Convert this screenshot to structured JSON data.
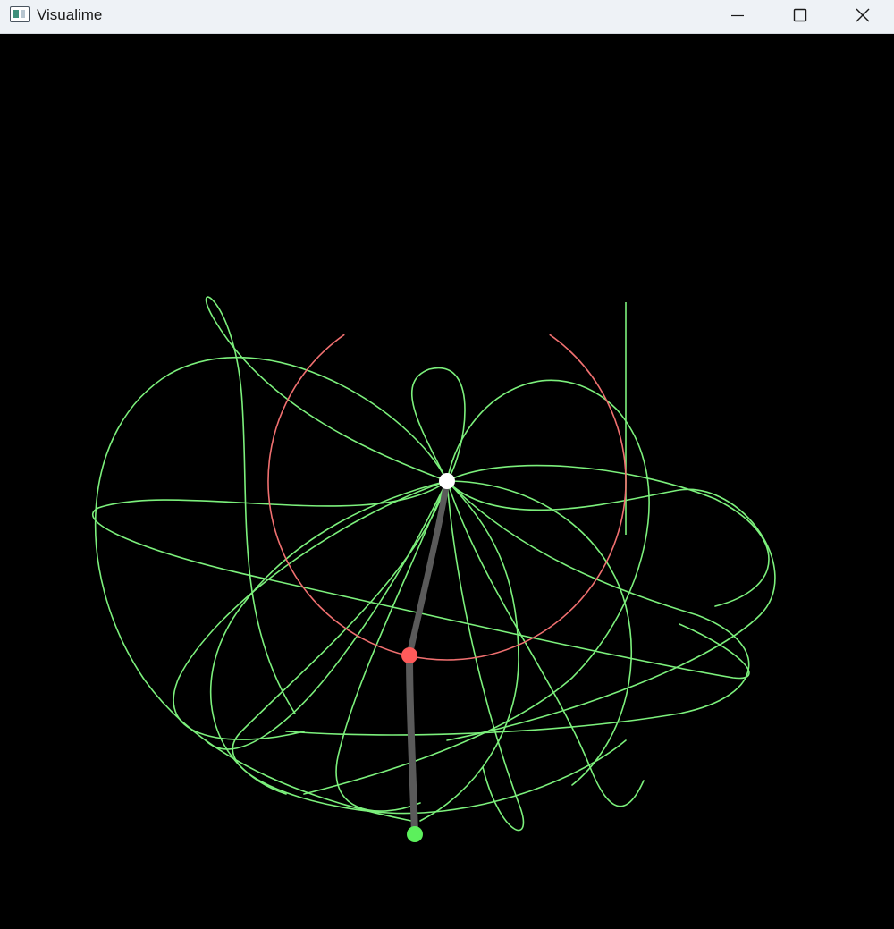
{
  "window": {
    "title": "Visualime",
    "controls": {
      "minimize": "minimize-icon",
      "maximize": "maximize-icon",
      "close": "close-icon"
    }
  },
  "scene": {
    "background": "#000000",
    "trail_color": "#7cf07c",
    "circle_color": "#f07070",
    "rod_color": "#5a5a5a",
    "pivot_color": "#ffffff",
    "bob1_color": "#ff5a5a",
    "bob2_color": "#5cf05c"
  }
}
